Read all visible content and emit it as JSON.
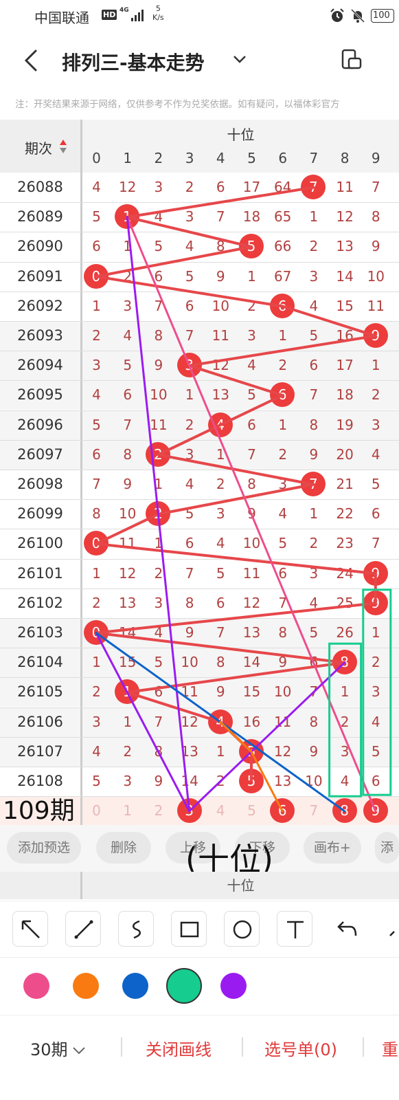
{
  "status_bar": {
    "carrier": "中国联通",
    "hd": "HD",
    "network": "4G",
    "speed_value": "5",
    "speed_unit": "K/s",
    "battery": "100"
  },
  "header": {
    "title": "排列三-基本走势"
  },
  "notice": "注：开奖结果来源于网络，仅供参考不作为兑奖依据。如有疑问，以福体彩官方",
  "table": {
    "period_header": "期次",
    "group_header": "十位",
    "digits": [
      "0",
      "1",
      "2",
      "3",
      "4",
      "5",
      "6",
      "7",
      "8",
      "9"
    ],
    "rows": [
      {
        "period": "26088",
        "cells": [
          "4",
          "12",
          "3",
          "2",
          "6",
          "17",
          "64",
          "7",
          "11",
          "7"
        ],
        "hit": 7
      },
      {
        "period": "26089",
        "cells": [
          "5",
          "1",
          "4",
          "3",
          "7",
          "18",
          "65",
          "1",
          "12",
          "8"
        ],
        "hit": 1
      },
      {
        "period": "26090",
        "cells": [
          "6",
          "1",
          "5",
          "4",
          "8",
          "5",
          "66",
          "2",
          "13",
          "9"
        ],
        "hit": 5
      },
      {
        "period": "26091",
        "cells": [
          "0",
          "2",
          "6",
          "5",
          "9",
          "1",
          "67",
          "3",
          "14",
          "10"
        ],
        "hit": 0
      },
      {
        "period": "26092",
        "cells": [
          "1",
          "3",
          "7",
          "6",
          "10",
          "2",
          "6",
          "4",
          "15",
          "11"
        ],
        "hit": 6
      },
      {
        "period": "26093",
        "cells": [
          "2",
          "4",
          "8",
          "7",
          "11",
          "3",
          "1",
          "5",
          "16",
          "9"
        ],
        "hit": 9
      },
      {
        "period": "26094",
        "cells": [
          "3",
          "5",
          "9",
          "3",
          "12",
          "4",
          "2",
          "6",
          "17",
          "1"
        ],
        "hit": 3
      },
      {
        "period": "26095",
        "cells": [
          "4",
          "6",
          "10",
          "1",
          "13",
          "5",
          "6",
          "7",
          "18",
          "2"
        ],
        "hit": 6
      },
      {
        "period": "26096",
        "cells": [
          "5",
          "7",
          "11",
          "2",
          "4",
          "6",
          "1",
          "8",
          "19",
          "3"
        ],
        "hit": 4
      },
      {
        "period": "26097",
        "cells": [
          "6",
          "8",
          "2",
          "3",
          "1",
          "7",
          "2",
          "9",
          "20",
          "4"
        ],
        "hit": 2
      },
      {
        "period": "26098",
        "cells": [
          "7",
          "9",
          "1",
          "4",
          "2",
          "8",
          "3",
          "7",
          "21",
          "5"
        ],
        "hit": 7
      },
      {
        "period": "26099",
        "cells": [
          "8",
          "10",
          "2",
          "5",
          "3",
          "9",
          "4",
          "1",
          "22",
          "6"
        ],
        "hit": 2
      },
      {
        "period": "26100",
        "cells": [
          "0",
          "11",
          "1",
          "6",
          "4",
          "10",
          "5",
          "2",
          "23",
          "7"
        ],
        "hit": 0
      },
      {
        "period": "26101",
        "cells": [
          "1",
          "12",
          "2",
          "7",
          "5",
          "11",
          "6",
          "3",
          "24",
          "9"
        ],
        "hit": 9
      },
      {
        "period": "26102",
        "cells": [
          "2",
          "13",
          "3",
          "8",
          "6",
          "12",
          "7",
          "4",
          "25",
          "9"
        ],
        "hit": 9
      },
      {
        "period": "26103",
        "cells": [
          "0",
          "14",
          "4",
          "9",
          "7",
          "13",
          "8",
          "5",
          "26",
          "1"
        ],
        "hit": 0
      },
      {
        "period": "26104",
        "cells": [
          "1",
          "15",
          "5",
          "10",
          "8",
          "14",
          "9",
          "6",
          "8",
          "2"
        ],
        "hit": 8
      },
      {
        "period": "26105",
        "cells": [
          "2",
          "1",
          "6",
          "11",
          "9",
          "15",
          "10",
          "7",
          "1",
          "3"
        ],
        "hit": 1
      },
      {
        "period": "26106",
        "cells": [
          "3",
          "1",
          "7",
          "12",
          "4",
          "16",
          "11",
          "8",
          "2",
          "4"
        ],
        "hit": 4
      },
      {
        "period": "26107",
        "cells": [
          "4",
          "2",
          "8",
          "13",
          "1",
          "5",
          "12",
          "9",
          "3",
          "5"
        ],
        "hit": 5
      },
      {
        "period": "26108",
        "cells": [
          "5",
          "3",
          "9",
          "14",
          "2",
          "5",
          "13",
          "10",
          "4",
          "6"
        ],
        "hit": 5
      }
    ],
    "prediction": {
      "label": "109期",
      "cells": [
        "0",
        "1",
        "2",
        "3",
        "4",
        "5",
        "6",
        "7",
        "8",
        "9"
      ],
      "selected": [
        3,
        6,
        8,
        9
      ]
    }
  },
  "actions": [
    "添加预选",
    "删除",
    "上移",
    "下移",
    "画布+",
    "添"
  ],
  "annotation_text": "(十位)",
  "sub_header": "十位",
  "tools": [
    "arrow-tool",
    "line-tool",
    "freehand-tool",
    "rectangle-tool",
    "circle-tool",
    "text-tool",
    "undo-tool"
  ],
  "colors": [
    "#ee4d8c",
    "#f97a10",
    "#0d63c9",
    "#16cc8f",
    "#9a1bf0"
  ],
  "bottom": {
    "period_select": "30期",
    "close_lines": "关闭画线",
    "pick_list": "选号单(0)",
    "more": "重"
  }
}
